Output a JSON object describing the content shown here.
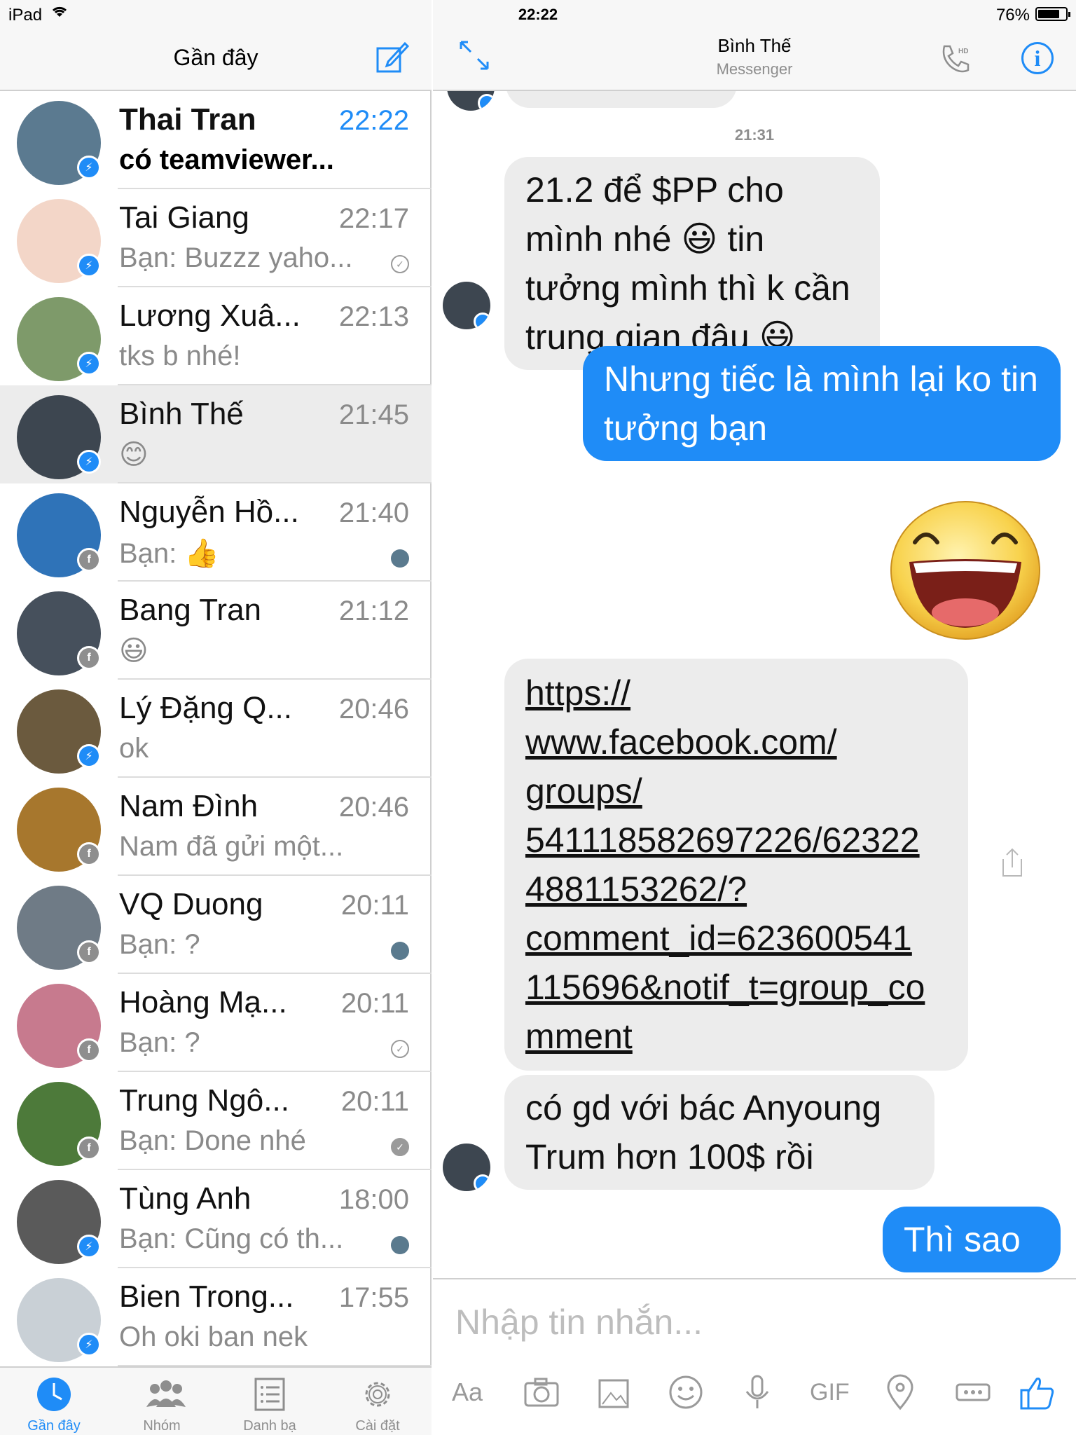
{
  "status": {
    "device": "iPad",
    "time": "22:22",
    "battery": "76%"
  },
  "left": {
    "title": "Gần đây",
    "conversations": [
      {
        "name": "Thai Tran",
        "time": "22:22",
        "snippet": "có teamviewer...",
        "unread": true,
        "badge": "messenger",
        "avatar_color": "#5b7a90"
      },
      {
        "name": "Tai Giang",
        "time": "22:17",
        "snippet": "Bạn: Buzzz yaho...",
        "badge": "messenger",
        "status": "check",
        "avatar_color": "#f3d6c8"
      },
      {
        "name": "Lương Xuâ...",
        "time": "22:13",
        "snippet": "tks b nhé!",
        "badge": "messenger",
        "avatar_color": "#7e9a6a"
      },
      {
        "name": "Bình Thế",
        "time": "21:45",
        "snippet": "😊",
        "badge": "messenger",
        "selected": true,
        "avatar_color": "#3d4650"
      },
      {
        "name": "Nguyễn Hồ...",
        "time": "21:40",
        "snippet": "Bạn: 👍",
        "badge": "facebook",
        "status": "face",
        "avatar_color": "#2f73b8"
      },
      {
        "name": "Bang Tran",
        "time": "21:12",
        "snippet": "😃",
        "badge": "facebook",
        "avatar_color": "#46505c"
      },
      {
        "name": "Lý Đặng Q...",
        "time": "20:46",
        "snippet": "ok",
        "badge": "messenger",
        "avatar_color": "#6b5a3e"
      },
      {
        "name": "Nam Đình",
        "time": "20:46",
        "snippet": "Nam đã gửi một...",
        "badge": "facebook",
        "avatar_color": "#a7772d"
      },
      {
        "name": "VQ Duong",
        "time": "20:11",
        "snippet": "Bạn: ?",
        "badge": "facebook",
        "status": "face",
        "avatar_color": "#6f7b86"
      },
      {
        "name": "Hoàng Mạ...",
        "time": "20:11",
        "snippet": "Bạn: ?",
        "badge": "facebook",
        "status": "check",
        "avatar_color": "#c77a8e"
      },
      {
        "name": "Trung Ngô...",
        "time": "20:11",
        "snippet": "Bạn: Done nhé",
        "badge": "facebook",
        "status": "check-filled",
        "avatar_color": "#4d7a3a"
      },
      {
        "name": "Tùng Anh",
        "time": "18:00",
        "snippet": "Bạn: Cũng có th...",
        "badge": "messenger",
        "status": "face",
        "avatar_color": "#5a5a5a"
      },
      {
        "name": "Bien Trong...",
        "time": "17:55",
        "snippet": "Oh oki ban nek",
        "badge": "messenger",
        "avatar_color": "#c9d0d6"
      }
    ],
    "tabs": [
      {
        "label": "Gần đây",
        "active": true
      },
      {
        "label": "Nhóm"
      },
      {
        "label": "Danh bạ"
      },
      {
        "label": "Cài đặt"
      }
    ]
  },
  "chat": {
    "name": "Bình Thế",
    "subtitle": "Messenger",
    "stamp": "21:31",
    "messages": [
      "21.2 để $PP cho mình nhé 😃 tin tưởng mình thì k cần trung gian đâu 😃",
      "Nhưng tiếc là mình lại ko tin tưởng bạn",
      "https://www.facebook.com/groups/541118582697226/623224881153262/?comment_id=623600541115696&notif_t=group_comment",
      "có gd với bác Anyoung Trum hơn 100$ rồi",
      "Thì sao"
    ],
    "link_lines": [
      "https://",
      "www.facebook.com/",
      "groups/",
      "541118582697226/62322",
      "4881153262/?",
      "comment_id=623600541",
      "115696&notif_t=group_co",
      "mment"
    ],
    "composer_placeholder": "Nhập tin nhắn...",
    "toolbar": {
      "text": "Aa",
      "gif": "GIF"
    }
  }
}
